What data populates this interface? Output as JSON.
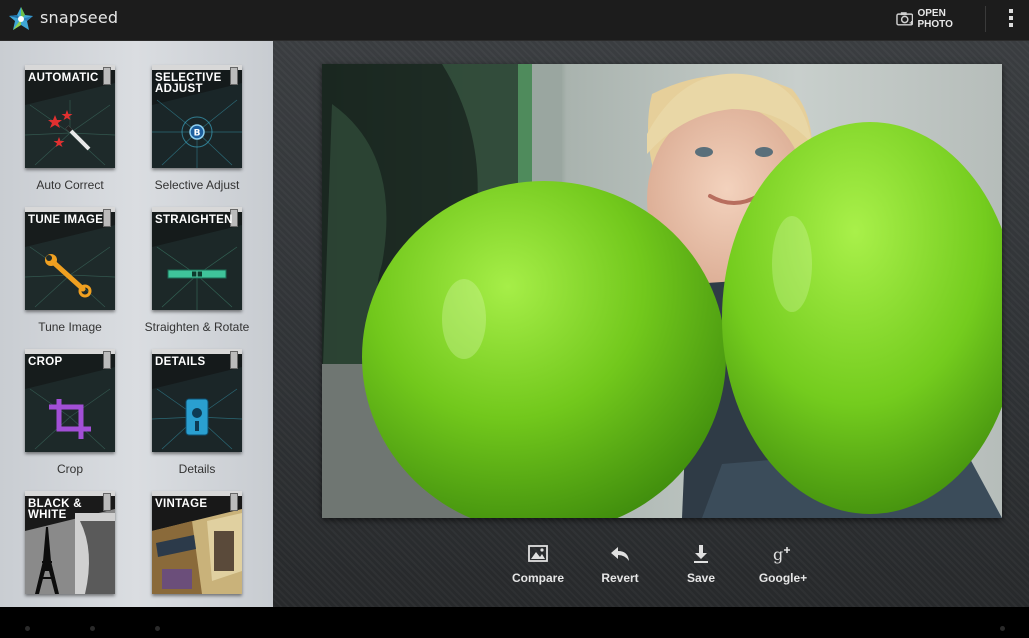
{
  "app": {
    "name": "snapseed",
    "logo_icon": "snapseed-logo-icon"
  },
  "topbar": {
    "open_photo_label": "OPEN PHOTO",
    "open_photo_icon": "camera-icon",
    "overflow_icon": "overflow-menu-icon"
  },
  "filters": [
    {
      "title": "Automatic",
      "label": "Auto Correct",
      "icon": "magic-wand-icon"
    },
    {
      "title": "Selective Adjust",
      "label": "Selective Adjust",
      "icon": "control-point-icon"
    },
    {
      "title": "Tune Image",
      "label": "Tune Image",
      "icon": "wrench-icon"
    },
    {
      "title": "Straighten",
      "label": "Straighten & Rotate",
      "icon": "level-icon"
    },
    {
      "title": "Crop",
      "label": "Crop",
      "icon": "crop-icon"
    },
    {
      "title": "Details",
      "label": "Details",
      "icon": "sharpener-icon"
    },
    {
      "title": "Black & White",
      "label": "",
      "icon": "eiffel-tower-thumbnail"
    },
    {
      "title": "Vintage",
      "label": "",
      "icon": "vintage-thumbnail"
    }
  ],
  "actions": [
    {
      "label": "Compare",
      "icon": "image-icon"
    },
    {
      "label": "Revert",
      "icon": "reply-arrow-icon"
    },
    {
      "label": "Save",
      "icon": "download-icon"
    },
    {
      "label": "Google+",
      "icon": "google-plus-icon"
    }
  ],
  "colors": {
    "balloon": "#7fd320",
    "panel": "#d3d6da",
    "topbar": "#1c1c1c"
  }
}
